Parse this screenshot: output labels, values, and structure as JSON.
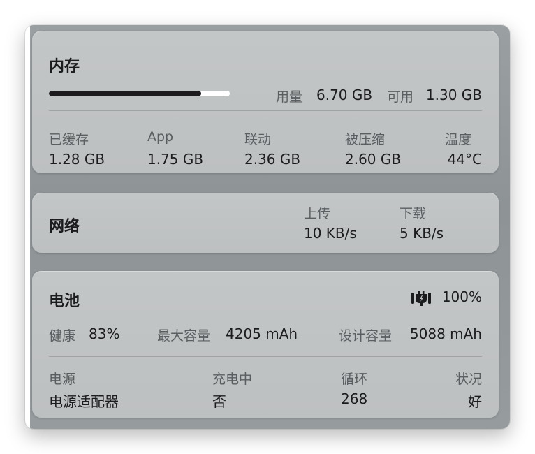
{
  "memory": {
    "title": "内存",
    "usage_fraction": 0.84,
    "used_label": "用量",
    "used_value": "6.70 GB",
    "available_label": "可用",
    "available_value": "1.30 GB",
    "stats": [
      {
        "label": "已缓存",
        "value": "1.28 GB"
      },
      {
        "label": "App",
        "value": "1.75 GB"
      },
      {
        "label": "联动",
        "value": "2.36 GB"
      },
      {
        "label": "被压缩",
        "value": "2.60 GB"
      },
      {
        "label": "温度",
        "value": "44°C"
      }
    ]
  },
  "network": {
    "title": "网络",
    "upload_label": "上传",
    "upload_value": "10 KB/s",
    "download_label": "下载",
    "download_value": "5 KB/s"
  },
  "battery": {
    "title": "电池",
    "icon": "plug-icon",
    "percent": "100%",
    "health_label": "健康",
    "health_value": "83%",
    "max_capacity_label": "最大容量",
    "max_capacity_value": "4205 mAh",
    "design_capacity_label": "设计容量",
    "design_capacity_value": "5088 mAh",
    "details": [
      {
        "label": "电源",
        "value": "电源适配器"
      },
      {
        "label": "充电中",
        "value": "否"
      },
      {
        "label": "循环",
        "value": "268"
      },
      {
        "label": "状况",
        "value": "好"
      }
    ]
  },
  "colors": {
    "bar_fill": "#1c1c1e",
    "bar_track": "#ffffff",
    "card": "#c1c4c5",
    "window": "#959b9d"
  }
}
